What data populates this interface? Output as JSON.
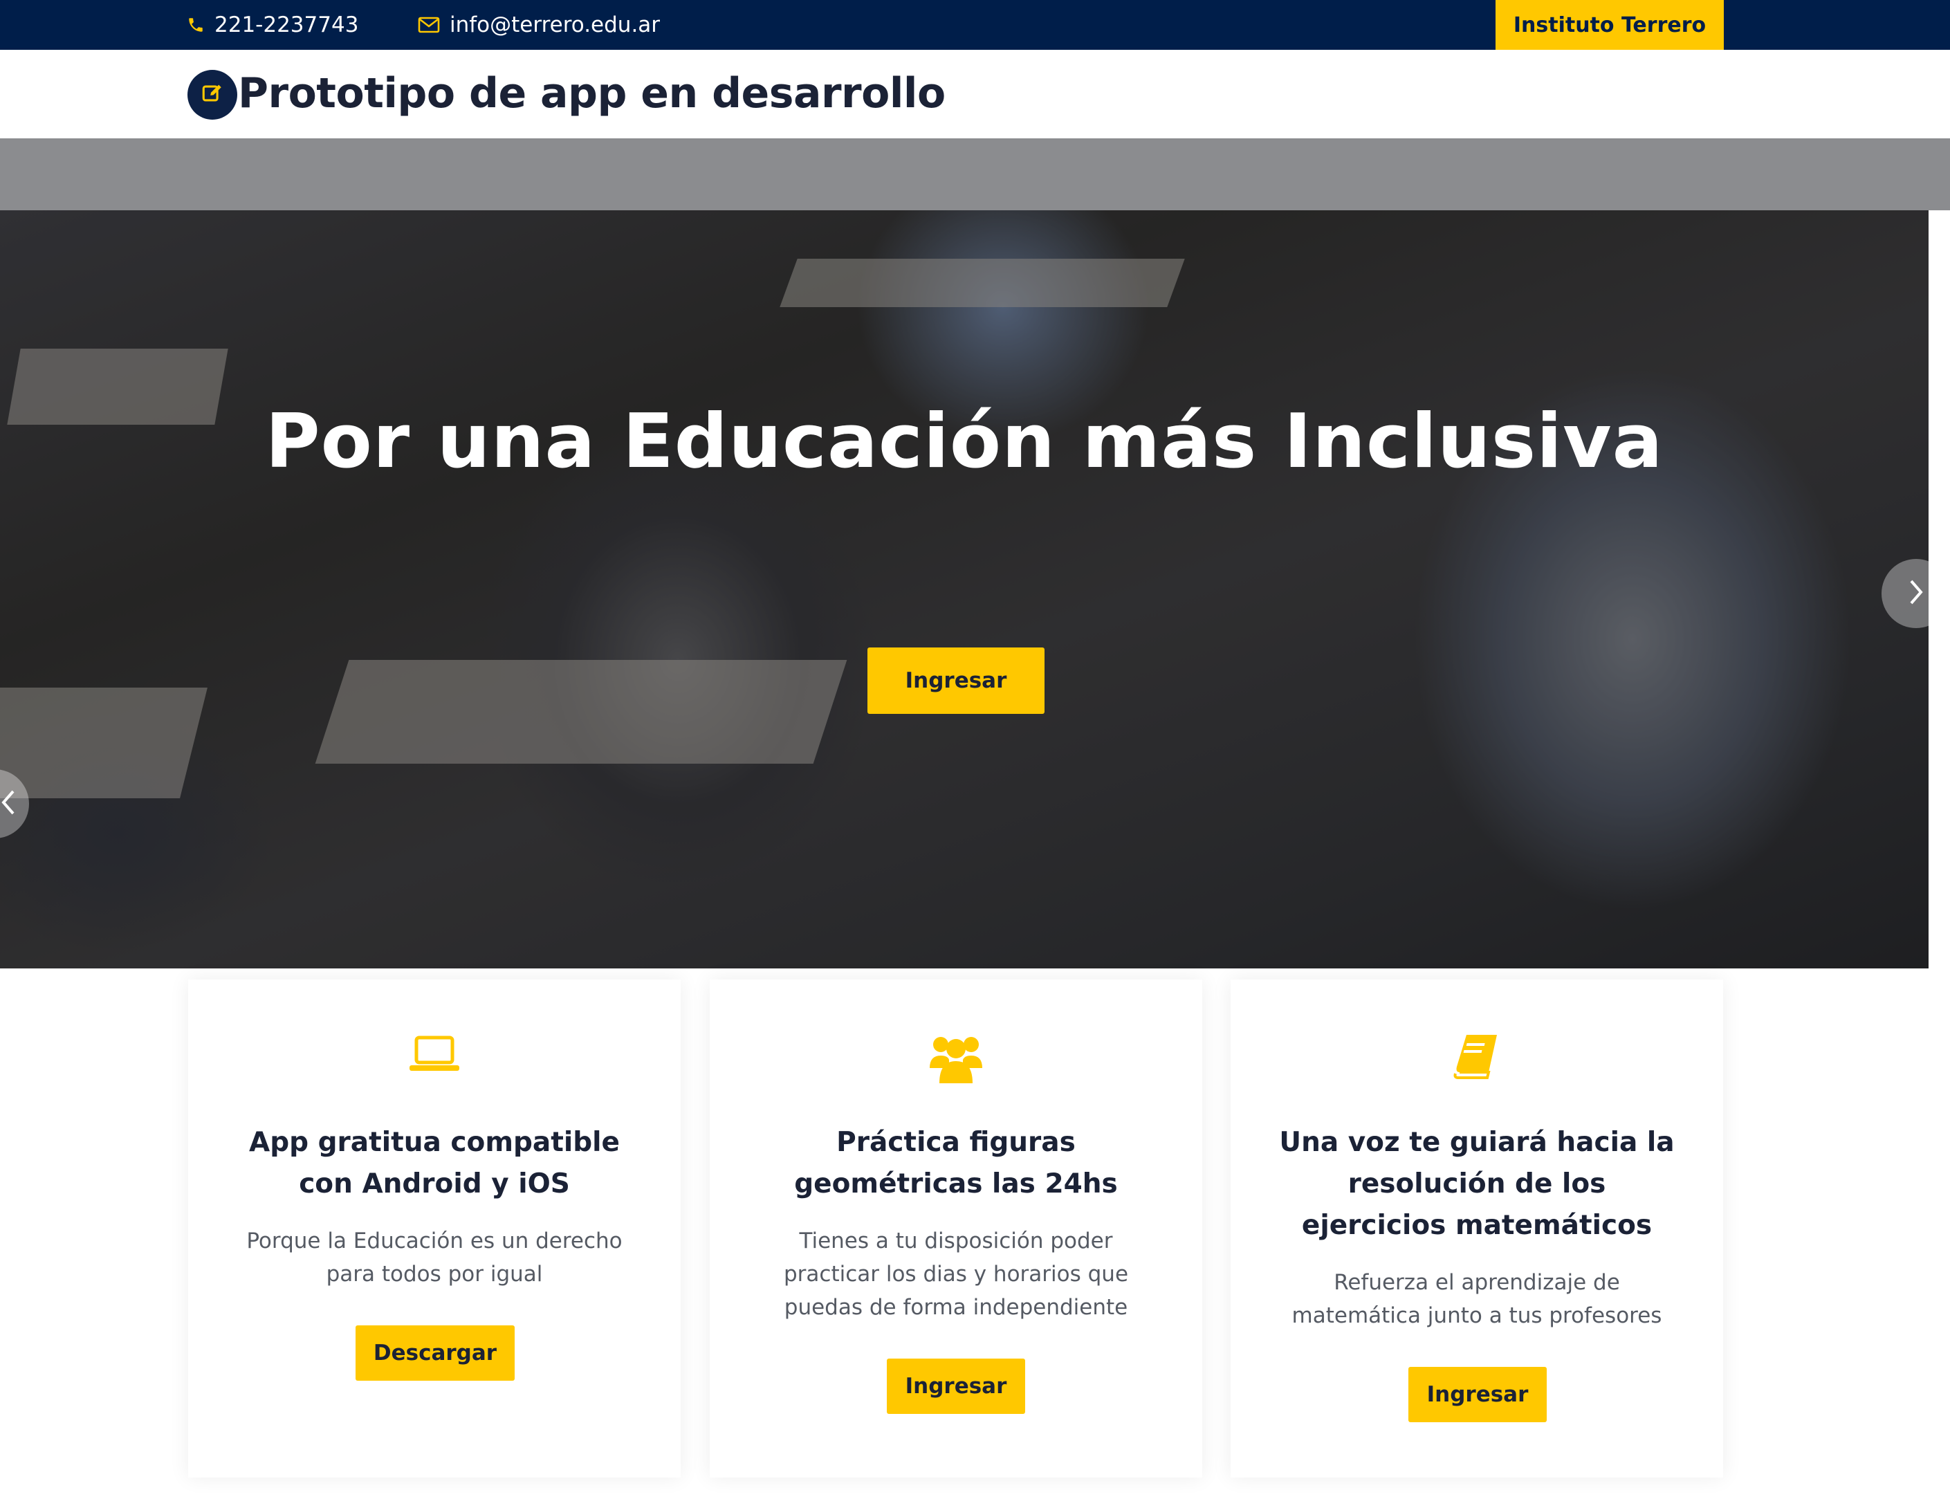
{
  "topbar": {
    "phone": "221-2237743",
    "email": "info@terrero.edu.ar",
    "institute_button": "Instituto Terrero",
    "phone_icon": "phone-icon",
    "email_icon": "envelope-icon"
  },
  "header": {
    "logo_icon": "edit-icon",
    "title": "Prototipo de app en desarrollo"
  },
  "hero": {
    "title": "Por una Educación más Inclusiva",
    "button": "Ingresar",
    "prev_icon": "chevron-left-icon",
    "next_icon": "chevron-right-icon"
  },
  "features": [
    {
      "icon": "laptop-icon",
      "title": "App gratitua compatible con Android y iOS",
      "description": "Porque la Educación es un derecho para todos por igual",
      "button": "Descargar"
    },
    {
      "icon": "users-icon",
      "title": "Práctica figuras geométricas las 24hs",
      "description": "Tienes a tu disposición poder practicar los dias y horarios que puedas de forma independiente",
      "button": "Ingresar"
    },
    {
      "icon": "book-icon",
      "title": "Una voz te guiará hacia la resolución de los ejercicios matemáticos",
      "description": "Refuerza el aprendizaje de matemática junto a tus profesores",
      "button": "Ingresar"
    }
  ],
  "colors": {
    "navy": "#001e4a",
    "accent_yellow": "#ffc800",
    "title_dark": "#1b2236",
    "text_gray": "#555a63"
  }
}
